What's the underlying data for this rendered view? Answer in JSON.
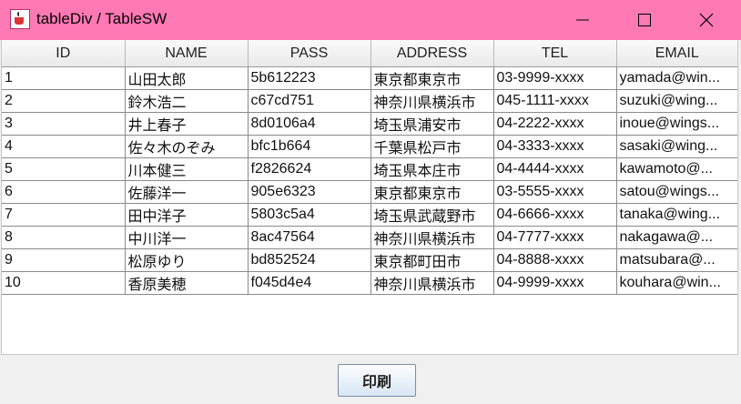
{
  "window": {
    "title": "tableDiv / TableSW",
    "accent_color": "#ff79b5",
    "icons": {
      "app": "java-cup-icon",
      "minimize": "minimize-icon",
      "maximize": "maximize-icon",
      "close": "close-icon"
    }
  },
  "table": {
    "columns": [
      "ID",
      "NAME",
      "PASS",
      "ADDRESS",
      "TEL",
      "EMAIL"
    ],
    "rows": [
      [
        "1",
        "山田太郎",
        "5b612223",
        "東京都東京市",
        "03-9999-xxxx",
        "yamada@win..."
      ],
      [
        "2",
        "鈴木浩二",
        "c67cd751",
        "神奈川県横浜市",
        "045-1111-xxxx",
        "suzuki@wing..."
      ],
      [
        "3",
        "井上春子",
        "8d0106a4",
        "埼玉県浦安市",
        "04-2222-xxxx",
        "inoue@wings..."
      ],
      [
        "4",
        "佐々木のぞみ",
        "bfc1b664",
        "千葉県松戸市",
        "04-3333-xxxx",
        "sasaki@wing..."
      ],
      [
        "5",
        "川本健三",
        "f2826624",
        "埼玉県本庄市",
        "04-4444-xxxx",
        "kawamoto@..."
      ],
      [
        "6",
        "佐藤洋一",
        "905e6323",
        "東京都東京市",
        "03-5555-xxxx",
        "satou@wings..."
      ],
      [
        "7",
        "田中洋子",
        "5803c5a4",
        "埼玉県武蔵野市",
        "04-6666-xxxx",
        "tanaka@wing..."
      ],
      [
        "8",
        "中川洋一",
        "8ac47564",
        "神奈川県横浜市",
        "04-7777-xxxx",
        "nakagawa@..."
      ],
      [
        "9",
        "松原ゆり",
        "bd852524",
        "東京都町田市",
        "04-8888-xxxx",
        "matsubara@..."
      ],
      [
        "10",
        "香原美穂",
        "f045d4e4",
        "神奈川県横浜市",
        "04-9999-xxxx",
        "kouhara@win..."
      ]
    ]
  },
  "footer": {
    "print_label": "印刷"
  }
}
